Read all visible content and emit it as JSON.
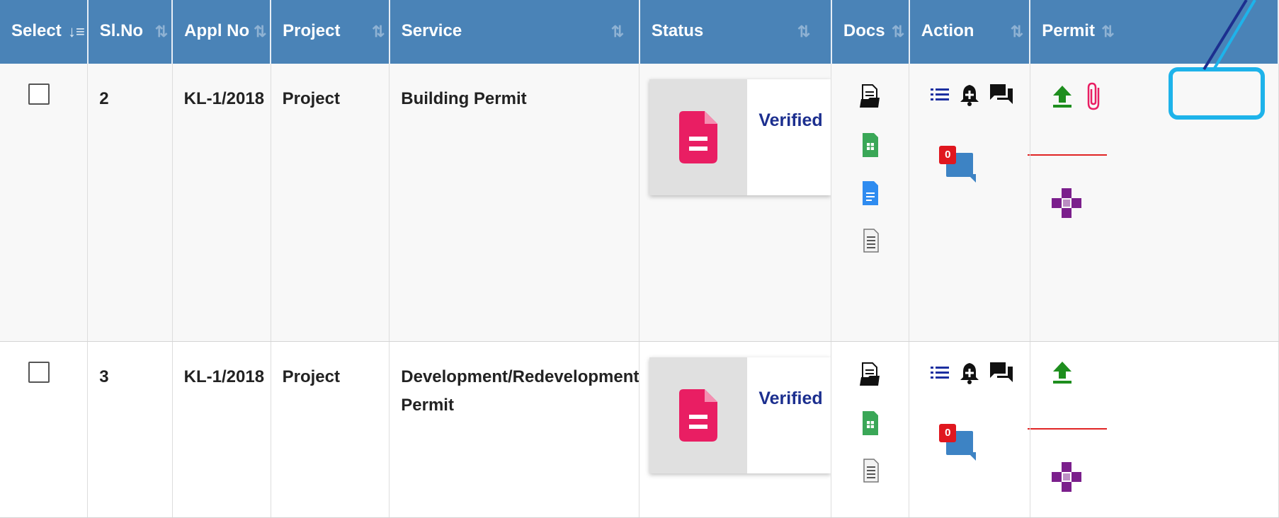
{
  "table": {
    "columns": [
      {
        "label": "Select",
        "active_sort": true
      },
      {
        "label": "Sl.No",
        "active_sort": false
      },
      {
        "label": "Appl No",
        "active_sort": false
      },
      {
        "label": "Project",
        "active_sort": false
      },
      {
        "label": "Service",
        "active_sort": false
      },
      {
        "label": "Status",
        "active_sort": false
      },
      {
        "label": "Docs",
        "active_sort": false
      },
      {
        "label": "Action",
        "active_sort": false
      },
      {
        "label": "Permit",
        "active_sort": false
      }
    ],
    "rows": [
      {
        "sl_no": "2",
        "appl_no": "KL-1/2018",
        "project": "Project",
        "service": "Building Permit",
        "status": "Verified",
        "message_count": "0"
      },
      {
        "sl_no": "3",
        "appl_no": "KL-1/2018",
        "project": "Project",
        "service": "Development/Redevelopment Permit",
        "status": "Verified",
        "message_count": "0"
      }
    ]
  },
  "icons": {
    "sort": "sort-icon",
    "status_document": "document-icon",
    "docs": [
      "folder-document-icon",
      "spreadsheet-icon",
      "text-document-icon",
      "plain-document-icon"
    ],
    "action": [
      "list-icon",
      "bell-add-icon",
      "chat-icon",
      "comment-icon"
    ],
    "permit": [
      "upload-icon",
      "attachment-icon",
      "puzzle-icon"
    ]
  },
  "colors": {
    "header_bg": "#4a83b7",
    "status_icon": "#e91e63",
    "verified_text": "#1c2f8f",
    "upload_icon": "#1e8e1e",
    "attachment_icon": "#e91e63",
    "puzzle_icon": "#7b1f8c",
    "badge": "#e0171f",
    "highlight": "#1eb3ea"
  }
}
